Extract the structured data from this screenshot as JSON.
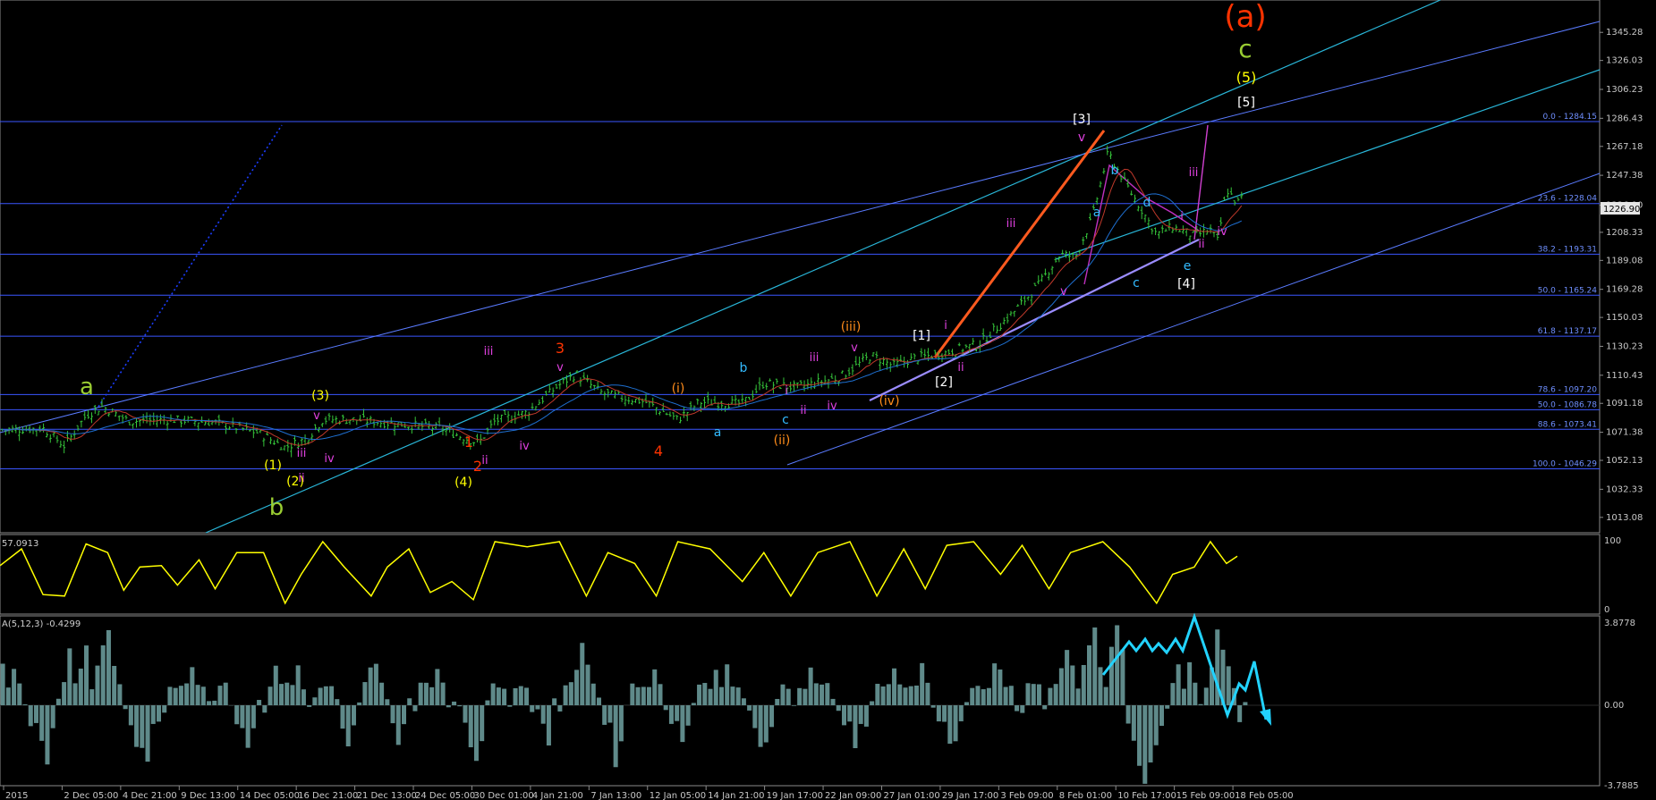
{
  "chart_data": {
    "type": "candlestick",
    "y_ticks": [
      "1345.28",
      "1326.03",
      "1306.23",
      "1286.43",
      "1267.18",
      "1247.38",
      "1226.90",
      "1208.33",
      "1189.08",
      "1169.28",
      "1150.03",
      "1130.23",
      "1110.43",
      "1091.18",
      "1071.38",
      "1052.13",
      "1032.33",
      "1013.08"
    ],
    "ylim": [
      1005,
      1365
    ],
    "current_price": "1226.90",
    "x_labels": [
      "2015",
      "2 Dec 05:00",
      "4 Dec 21:00",
      "9 Dec 13:00",
      "14 Dec 05:00",
      "16 Dec 21:00",
      "21 Dec 13:00",
      "24 Dec 05:00",
      "30 Dec 01:00",
      "4 Jan 21:00",
      "7 Jan 13:00",
      "12 Jan 05:00",
      "14 Jan 21:00",
      "19 Jan 17:00",
      "22 Jan 09:00",
      "27 Jan 01:00",
      "29 Jan 17:00",
      "3 Feb 09:00",
      "8 Feb 01:00",
      "10 Feb 17:00",
      "15 Feb 09:00",
      "18 Feb 05:00"
    ],
    "fib_levels": [
      {
        "label": "0.0 - 1284.15",
        "value": 1284.15
      },
      {
        "label": "23.6 - 1228.04",
        "value": 1228.04
      },
      {
        "label": "38.2 - 1193.31",
        "value": 1193.31
      },
      {
        "label": "50.0 - 1165.24",
        "value": 1165.24
      },
      {
        "label": "61.8 - 1137.17",
        "value": 1137.17
      },
      {
        "label": "78.6 - 1097.20",
        "value": 1097.2
      },
      {
        "label": "50.0 - 1086.78",
        "value": 1086.78
      },
      {
        "label": "88.6 - 1073.41",
        "value": 1073.41
      },
      {
        "label": "100.0 - 1046.29",
        "value": 1046.29
      }
    ],
    "price_series": [
      [
        0,
        1073
      ],
      [
        40,
        1074
      ],
      [
        60,
        1062
      ],
      [
        80,
        1083
      ],
      [
        95,
        1089
      ],
      [
        120,
        1079
      ],
      [
        160,
        1080
      ],
      [
        200,
        1078
      ],
      [
        240,
        1071
      ],
      [
        265,
        1061
      ],
      [
        285,
        1067
      ],
      [
        300,
        1080
      ],
      [
        330,
        1080
      ],
      [
        370,
        1077
      ],
      [
        410,
        1074
      ],
      [
        430,
        1068
      ],
      [
        445,
        1064
      ],
      [
        460,
        1079
      ],
      [
        490,
        1085
      ],
      [
        520,
        1104
      ],
      [
        535,
        1111
      ],
      [
        560,
        1098
      ],
      [
        600,
        1092
      ],
      [
        630,
        1080
      ],
      [
        650,
        1092
      ],
      [
        690,
        1091
      ],
      [
        710,
        1105
      ],
      [
        740,
        1102
      ],
      [
        780,
        1109
      ],
      [
        810,
        1124
      ],
      [
        830,
        1117
      ],
      [
        850,
        1122
      ],
      [
        880,
        1126
      ],
      [
        910,
        1132
      ],
      [
        940,
        1152
      ],
      [
        965,
        1172
      ],
      [
        985,
        1193
      ],
      [
        1000,
        1192
      ],
      [
        1015,
        1218
      ],
      [
        1030,
        1263
      ],
      [
        1045,
        1243
      ],
      [
        1060,
        1225
      ],
      [
        1075,
        1207
      ],
      [
        1090,
        1212
      ],
      [
        1110,
        1206
      ],
      [
        1125,
        1210
      ],
      [
        1132,
        1202
      ],
      [
        1140,
        1238
      ],
      [
        1150,
        1228
      ],
      [
        1155,
        1233
      ]
    ],
    "oscillator": {
      "label": "57.0913",
      "scale_top": "100",
      "scale_bottom": "0",
      "series": [
        [
          0,
          62
        ],
        [
          20,
          85
        ],
        [
          40,
          22
        ],
        [
          60,
          20
        ],
        [
          80,
          92
        ],
        [
          100,
          80
        ],
        [
          115,
          28
        ],
        [
          130,
          60
        ],
        [
          150,
          62
        ],
        [
          165,
          35
        ],
        [
          185,
          70
        ],
        [
          200,
          30
        ],
        [
          220,
          80
        ],
        [
          245,
          80
        ],
        [
          265,
          10
        ],
        [
          280,
          50
        ],
        [
          300,
          95
        ],
        [
          320,
          60
        ],
        [
          345,
          20
        ],
        [
          360,
          60
        ],
        [
          380,
          85
        ],
        [
          400,
          25
        ],
        [
          420,
          40
        ],
        [
          440,
          15
        ],
        [
          460,
          95
        ],
        [
          490,
          88
        ],
        [
          520,
          95
        ],
        [
          545,
          20
        ],
        [
          565,
          80
        ],
        [
          590,
          65
        ],
        [
          610,
          20
        ],
        [
          630,
          95
        ],
        [
          660,
          85
        ],
        [
          690,
          40
        ],
        [
          710,
          80
        ],
        [
          735,
          20
        ],
        [
          760,
          80
        ],
        [
          790,
          95
        ],
        [
          815,
          20
        ],
        [
          840,
          85
        ],
        [
          860,
          30
        ],
        [
          880,
          90
        ],
        [
          905,
          95
        ],
        [
          930,
          50
        ],
        [
          950,
          90
        ],
        [
          975,
          30
        ],
        [
          995,
          80
        ],
        [
          1025,
          95
        ],
        [
          1050,
          60
        ],
        [
          1075,
          10
        ],
        [
          1090,
          50
        ],
        [
          1110,
          60
        ],
        [
          1125,
          95
        ],
        [
          1140,
          65
        ],
        [
          1150,
          75
        ]
      ]
    },
    "histogram": {
      "label": "A(5,12,3) -0.4299",
      "scale_top": "3.8778",
      "scale_zero": "0.00",
      "scale_bottom": "-3.7885",
      "values": [
        2,
        1,
        2,
        1,
        0,
        -1,
        -1,
        -2,
        -3,
        -1,
        0,
        1,
        3,
        1,
        2,
        3,
        1,
        2,
        3,
        4,
        2,
        1,
        0,
        -1,
        -2,
        -2,
        -3,
        -1,
        -1,
        0,
        1,
        1,
        1,
        1,
        2,
        1,
        1,
        0,
        0,
        1,
        1,
        0,
        -1,
        -1,
        -2,
        -1,
        0,
        0,
        1,
        2,
        1,
        1,
        1,
        2,
        1,
        0,
        0,
        1,
        1,
        1,
        0,
        -1,
        -2,
        -1,
        0,
        1,
        2,
        2,
        1,
        0,
        -1,
        -2,
        -1,
        0,
        0,
        1,
        1,
        1,
        2,
        1,
        0,
        0,
        0,
        -1,
        -2,
        -3,
        -2,
        0,
        1,
        1,
        1,
        0,
        1,
        1,
        1,
        0,
        0,
        -1,
        -2,
        0,
        0,
        1,
        1,
        2,
        3,
        2,
        1,
        0,
        -1,
        -1,
        -3,
        -2,
        0,
        1,
        1,
        1,
        1,
        2,
        1,
        0,
        -1,
        -1,
        -2,
        -1,
        0,
        1,
        1,
        1,
        2,
        1,
        2,
        1,
        1,
        0,
        0,
        -1,
        -2,
        -2,
        -1,
        0,
        1,
        1,
        0,
        1,
        1,
        2,
        1,
        1,
        1,
        0,
        0,
        -1,
        -1,
        -2,
        -1,
        -1,
        0,
        1,
        1,
        1,
        2,
        1,
        1,
        1,
        1,
        2,
        1,
        0,
        -1,
        -1,
        -2,
        -2,
        -1,
        0,
        1,
        1,
        1,
        1,
        2,
        2,
        1,
        1,
        0,
        0,
        1,
        1,
        1,
        0,
        1,
        1,
        2,
        3,
        2,
        1,
        2,
        3,
        4,
        2,
        1,
        3,
        4,
        3,
        -1,
        -2,
        -3,
        -4,
        -3,
        -2,
        -1,
        0,
        1,
        2,
        1,
        2,
        1,
        0,
        1,
        2,
        4,
        3,
        2,
        1,
        -1,
        0
      ]
    },
    "wave_labels": [
      {
        "text": "(a)",
        "color": "#ff3300",
        "size": 34
      },
      {
        "text": "c",
        "color": "#9acd32",
        "size": 28
      },
      {
        "text": "(5)",
        "color": "#ffff00",
        "size": 16
      },
      {
        "text": "[5]",
        "color": "#ffffff",
        "size": 14
      },
      {
        "text": "[3]",
        "color": "#ffffff",
        "size": 14
      },
      {
        "text": "v",
        "color": "#e040e0",
        "size": 14
      },
      {
        "text": "b",
        "color": "#33bbff",
        "size": 14
      },
      {
        "text": "d",
        "color": "#33bbff",
        "size": 14
      },
      {
        "text": "a",
        "color": "#33bbff",
        "size": 14
      },
      {
        "text": "iii",
        "color": "#e040e0",
        "size": 13
      },
      {
        "text": "i",
        "color": "#e040e0",
        "size": 13
      },
      {
        "text": "iv",
        "color": "#e040e0",
        "size": 13
      },
      {
        "text": "ii",
        "color": "#e040e0",
        "size": 13
      },
      {
        "text": "e",
        "color": "#33bbff",
        "size": 14
      },
      {
        "text": "c",
        "color": "#33bbff",
        "size": 14
      },
      {
        "text": "[4]",
        "color": "#ffffff",
        "size": 14
      },
      {
        "text": "iii",
        "color": "#e040e0",
        "size": 13
      },
      {
        "text": "v",
        "color": "#e040e0",
        "size": 13
      },
      {
        "text": "i",
        "color": "#e040e0",
        "size": 13
      },
      {
        "text": "ii",
        "color": "#e040e0",
        "size": 13
      },
      {
        "text": "[1]",
        "color": "#ffffff",
        "size": 14
      },
      {
        "text": "[2]",
        "color": "#ffffff",
        "size": 14
      },
      {
        "text": "(iii)",
        "color": "#ff8c1a",
        "size": 14
      },
      {
        "text": "v",
        "color": "#e040e0",
        "size": 13
      },
      {
        "text": "(iv)",
        "color": "#ff8c1a",
        "size": 14
      },
      {
        "text": "iii",
        "color": "#e040e0",
        "size": 13
      },
      {
        "text": "iv",
        "color": "#e040e0",
        "size": 13
      },
      {
        "text": "i",
        "color": "#e040e0",
        "size": 13
      },
      {
        "text": "ii",
        "color": "#e040e0",
        "size": 13
      },
      {
        "text": "b",
        "color": "#33bbff",
        "size": 14
      },
      {
        "text": "c",
        "color": "#33bbff",
        "size": 14
      },
      {
        "text": "a",
        "color": "#33bbff",
        "size": 14
      },
      {
        "text": "(i)",
        "color": "#ff8c1a",
        "size": 14
      },
      {
        "text": "(ii)",
        "color": "#ff8c1a",
        "size": 14
      },
      {
        "text": "3",
        "color": "#ff3300",
        "size": 16
      },
      {
        "text": "v",
        "color": "#e040e0",
        "size": 13
      },
      {
        "text": "4",
        "color": "#ff3300",
        "size": 16
      },
      {
        "text": "iii",
        "color": "#e040e0",
        "size": 13
      },
      {
        "text": "iv",
        "color": "#e040e0",
        "size": 13
      },
      {
        "text": "1",
        "color": "#ff3300",
        "size": 16
      },
      {
        "text": "ii",
        "color": "#e040e0",
        "size": 13
      },
      {
        "text": "2",
        "color": "#ff3300",
        "size": 16
      },
      {
        "text": "(4)",
        "color": "#ffff00",
        "size": 14
      },
      {
        "text": "(3)",
        "color": "#ffff00",
        "size": 14
      },
      {
        "text": "v",
        "color": "#e040e0",
        "size": 13
      },
      {
        "text": "iii",
        "color": "#e040e0",
        "size": 13
      },
      {
        "text": "iv",
        "color": "#e040e0",
        "size": 13
      },
      {
        "text": "(1)",
        "color": "#ffff00",
        "size": 14
      },
      {
        "text": "ii",
        "color": "#e040e0",
        "size": 13
      },
      {
        "text": "(2)",
        "color": "#ffff00",
        "size": 14
      },
      {
        "text": "a",
        "color": "#9acd32",
        "size": 26
      },
      {
        "text": "b",
        "color": "#9acd32",
        "size": 26
      }
    ]
  }
}
